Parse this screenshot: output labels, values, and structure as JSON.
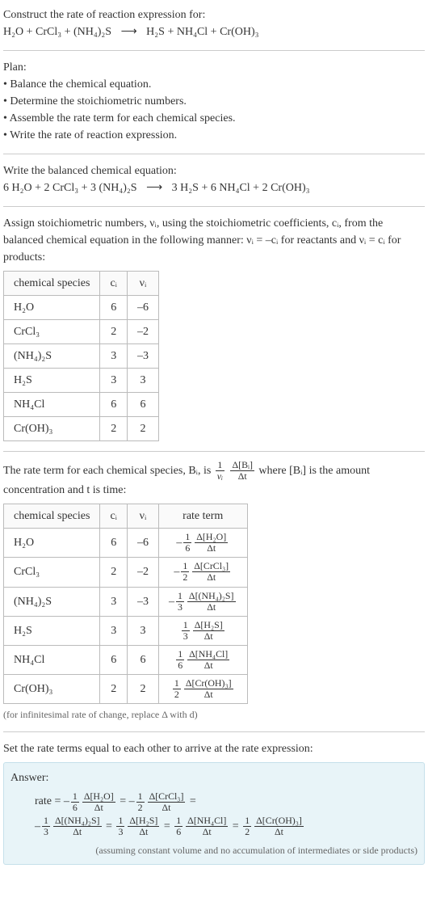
{
  "title": "Construct the rate of reaction expression for:",
  "equation_unbalanced_lhs": "H₂O + CrCl₃ + (NH₄)₂S",
  "arrow": "⟶",
  "equation_unbalanced_rhs": "H₂S + NH₄Cl + Cr(OH)₃",
  "plan_heading": "Plan:",
  "plan_items": [
    "Balance the chemical equation.",
    "Determine the stoichiometric numbers.",
    "Assemble the rate term for each chemical species.",
    "Write the rate of reaction expression."
  ],
  "balanced_heading": "Write the balanced chemical equation:",
  "equation_balanced_lhs": "6 H₂O + 2 CrCl₃ + 3 (NH₄)₂S",
  "equation_balanced_rhs": "3 H₂S + 6 NH₄Cl + 2 Cr(OH)₃",
  "assign_paragraph_1": "Assign stoichiometric numbers, νᵢ, using the stoichiometric coefficients, cᵢ, from the balanced chemical equation in the following manner: νᵢ = –cᵢ for reactants and νᵢ = cᵢ for products:",
  "table1_headers": {
    "species": "chemical species",
    "ci": "cᵢ",
    "vi": "νᵢ"
  },
  "table1_rows": [
    {
      "species": "H₂O",
      "ci": "6",
      "vi": "–6"
    },
    {
      "species": "CrCl₃",
      "ci": "2",
      "vi": "–2"
    },
    {
      "species": "(NH₄)₂S",
      "ci": "3",
      "vi": "–3"
    },
    {
      "species": "H₂S",
      "ci": "3",
      "vi": "3"
    },
    {
      "species": "NH₄Cl",
      "ci": "6",
      "vi": "6"
    },
    {
      "species": "Cr(OH)₃",
      "ci": "2",
      "vi": "2"
    }
  ],
  "rate_term_paragraph_a": "The rate term for each chemical species, Bᵢ, is ",
  "rate_term_frac1_num": "1",
  "rate_term_frac1_den": "νᵢ",
  "rate_term_frac2_num": "Δ[Bᵢ]",
  "rate_term_frac2_den": "Δt",
  "rate_term_paragraph_b": " where [Bᵢ] is the amount concentration and t is time:",
  "table2_headers": {
    "species": "chemical species",
    "ci": "cᵢ",
    "vi": "νᵢ",
    "rate": "rate term"
  },
  "table2_rows": [
    {
      "species": "H₂O",
      "ci": "6",
      "vi": "–6",
      "sign": "–",
      "fn": "1",
      "fd": "6",
      "dn": "Δ[H₂O]",
      "dd": "Δt"
    },
    {
      "species": "CrCl₃",
      "ci": "2",
      "vi": "–2",
      "sign": "–",
      "fn": "1",
      "fd": "2",
      "dn": "Δ[CrCl₃]",
      "dd": "Δt"
    },
    {
      "species": "(NH₄)₂S",
      "ci": "3",
      "vi": "–3",
      "sign": "–",
      "fn": "1",
      "fd": "3",
      "dn": "Δ[(NH₄)₂S]",
      "dd": "Δt"
    },
    {
      "species": "H₂S",
      "ci": "3",
      "vi": "3",
      "sign": "",
      "fn": "1",
      "fd": "3",
      "dn": "Δ[H₂S]",
      "dd": "Δt"
    },
    {
      "species": "NH₄Cl",
      "ci": "6",
      "vi": "6",
      "sign": "",
      "fn": "1",
      "fd": "6",
      "dn": "Δ[NH₄Cl]",
      "dd": "Δt"
    },
    {
      "species": "Cr(OH)₃",
      "ci": "2",
      "vi": "2",
      "sign": "",
      "fn": "1",
      "fd": "2",
      "dn": "Δ[Cr(OH)₃]",
      "dd": "Δt"
    }
  ],
  "infinitesimal_note": "(for infinitesimal rate of change, replace Δ with d)",
  "set_equal": "Set the rate terms equal to each other to arrive at the rate expression:",
  "answer_label": "Answer:",
  "rate_prefix": "rate = ",
  "eq": " = ",
  "answer_note": "(assuming constant volume and no accumulation of intermediates or side products)",
  "chart_data": {
    "type": "table",
    "title": "Stoichiometric numbers and rate terms",
    "series": [
      {
        "name": "stoichiometric_table",
        "columns": [
          "chemical species",
          "cᵢ",
          "νᵢ"
        ],
        "rows": [
          [
            "H₂O",
            6,
            -6
          ],
          [
            "CrCl₃",
            2,
            -2
          ],
          [
            "(NH₄)₂S",
            3,
            -3
          ],
          [
            "H₂S",
            3,
            3
          ],
          [
            "NH₄Cl",
            6,
            6
          ],
          [
            "Cr(OH)₃",
            2,
            2
          ]
        ]
      },
      {
        "name": "rate_term_table",
        "columns": [
          "chemical species",
          "cᵢ",
          "νᵢ",
          "rate term"
        ],
        "rows": [
          [
            "H₂O",
            6,
            -6,
            "–(1/6) Δ[H₂O]/Δt"
          ],
          [
            "CrCl₃",
            2,
            -2,
            "–(1/2) Δ[CrCl₃]/Δt"
          ],
          [
            "(NH₄)₂S",
            3,
            -3,
            "–(1/3) Δ[(NH₄)₂S]/Δt"
          ],
          [
            "H₂S",
            3,
            3,
            "(1/3) Δ[H₂S]/Δt"
          ],
          [
            "NH₄Cl",
            6,
            6,
            "(1/6) Δ[NH₄Cl]/Δt"
          ],
          [
            "Cr(OH)₃",
            2,
            2,
            "(1/2) Δ[Cr(OH)₃]/Δt"
          ]
        ]
      }
    ]
  }
}
